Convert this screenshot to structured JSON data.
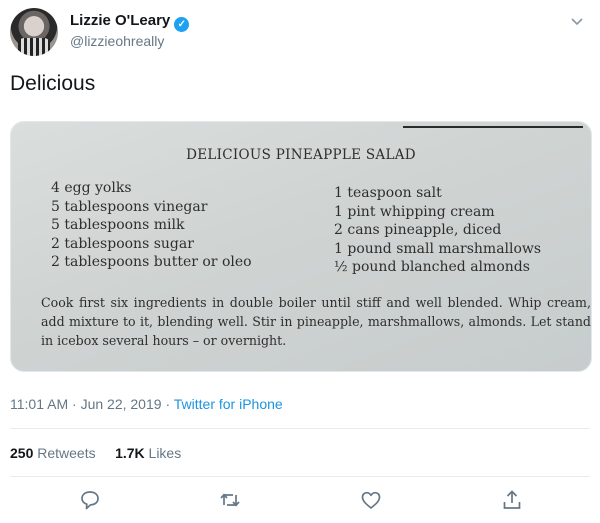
{
  "author": {
    "name": "Lizzie O'Leary",
    "handle": "@lizzieohreally",
    "verified_mark": "✓"
  },
  "tweet": {
    "text": "Delicious"
  },
  "photo": {
    "title": "DELICIOUS PINEAPPLE SALAD",
    "left_ingredients": [
      "4 egg yolks",
      "5 tablespoons vinegar",
      "5 tablespoons milk",
      "2 tablespoons sugar",
      "2 tablespoons butter or oleo"
    ],
    "right_ingredients": [
      "1 teaspoon salt",
      "1 pint whipping cream",
      "2 cans pineapple, diced",
      "1 pound small marshmallows",
      "½ pound blanched almonds"
    ],
    "instructions": "Cook first six ingredients in double boiler until stiff and well blended. Whip cream, add mixture to it, blending well. Stir in pineapple, marshmallows, almonds. Let stand in icebox several hours – or overnight."
  },
  "meta": {
    "time": "11:01 AM",
    "date": "Jun 22, 2019",
    "separator": "·",
    "source": "Twitter for iPhone"
  },
  "stats": {
    "retweets_count": "250",
    "retweets_label": "Retweets",
    "likes_count": "1.7K",
    "likes_label": "Likes"
  },
  "icons": {
    "reply": "reply-icon",
    "retweet": "retweet-icon",
    "like": "heart-icon",
    "share": "share-icon",
    "more": "chevron-down-icon"
  },
  "colors": {
    "text": "#14171a",
    "secondary": "#657786",
    "link": "#1b95e0",
    "verified": "#1da1f2"
  }
}
